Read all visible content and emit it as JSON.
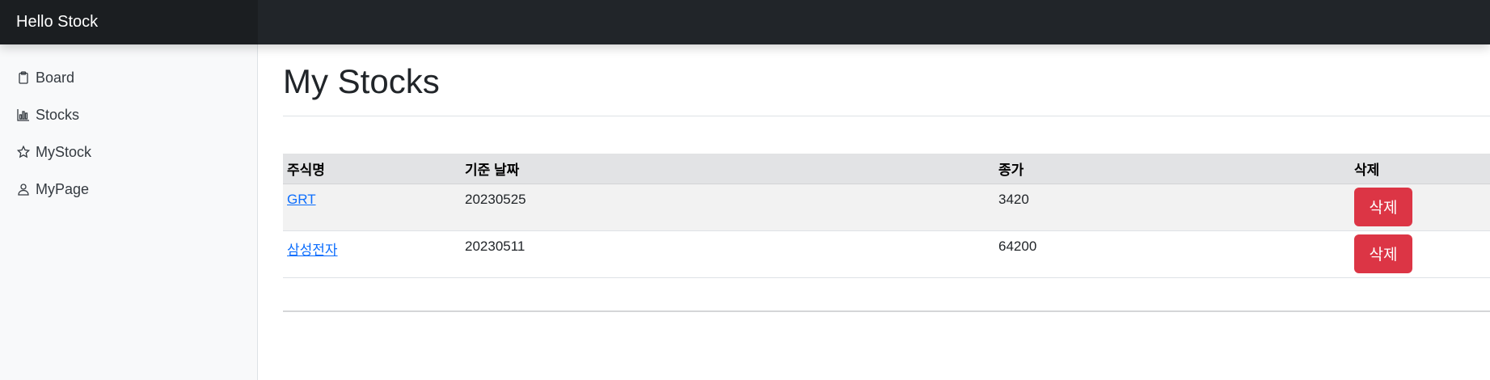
{
  "brand": "Hello Stock",
  "sidebar": {
    "items": [
      {
        "label": "Board",
        "icon": "clipboard-icon"
      },
      {
        "label": "Stocks",
        "icon": "bar-chart-icon"
      },
      {
        "label": "MyStock",
        "icon": "star-icon"
      },
      {
        "label": "MyPage",
        "icon": "person-icon"
      }
    ]
  },
  "main": {
    "title": "My Stocks",
    "table": {
      "headers": [
        "주식명",
        "기준 날짜",
        "종가",
        "삭제"
      ],
      "rows": [
        {
          "name": "GRT",
          "date": "20230525",
          "close": "3420",
          "delete_label": "삭제"
        },
        {
          "name": "삼성전자",
          "date": "20230511",
          "close": "64200",
          "delete_label": "삭제"
        }
      ]
    }
  },
  "colors": {
    "topbar": "#212529",
    "danger": "#dc3545",
    "link": "#0d6efd"
  }
}
